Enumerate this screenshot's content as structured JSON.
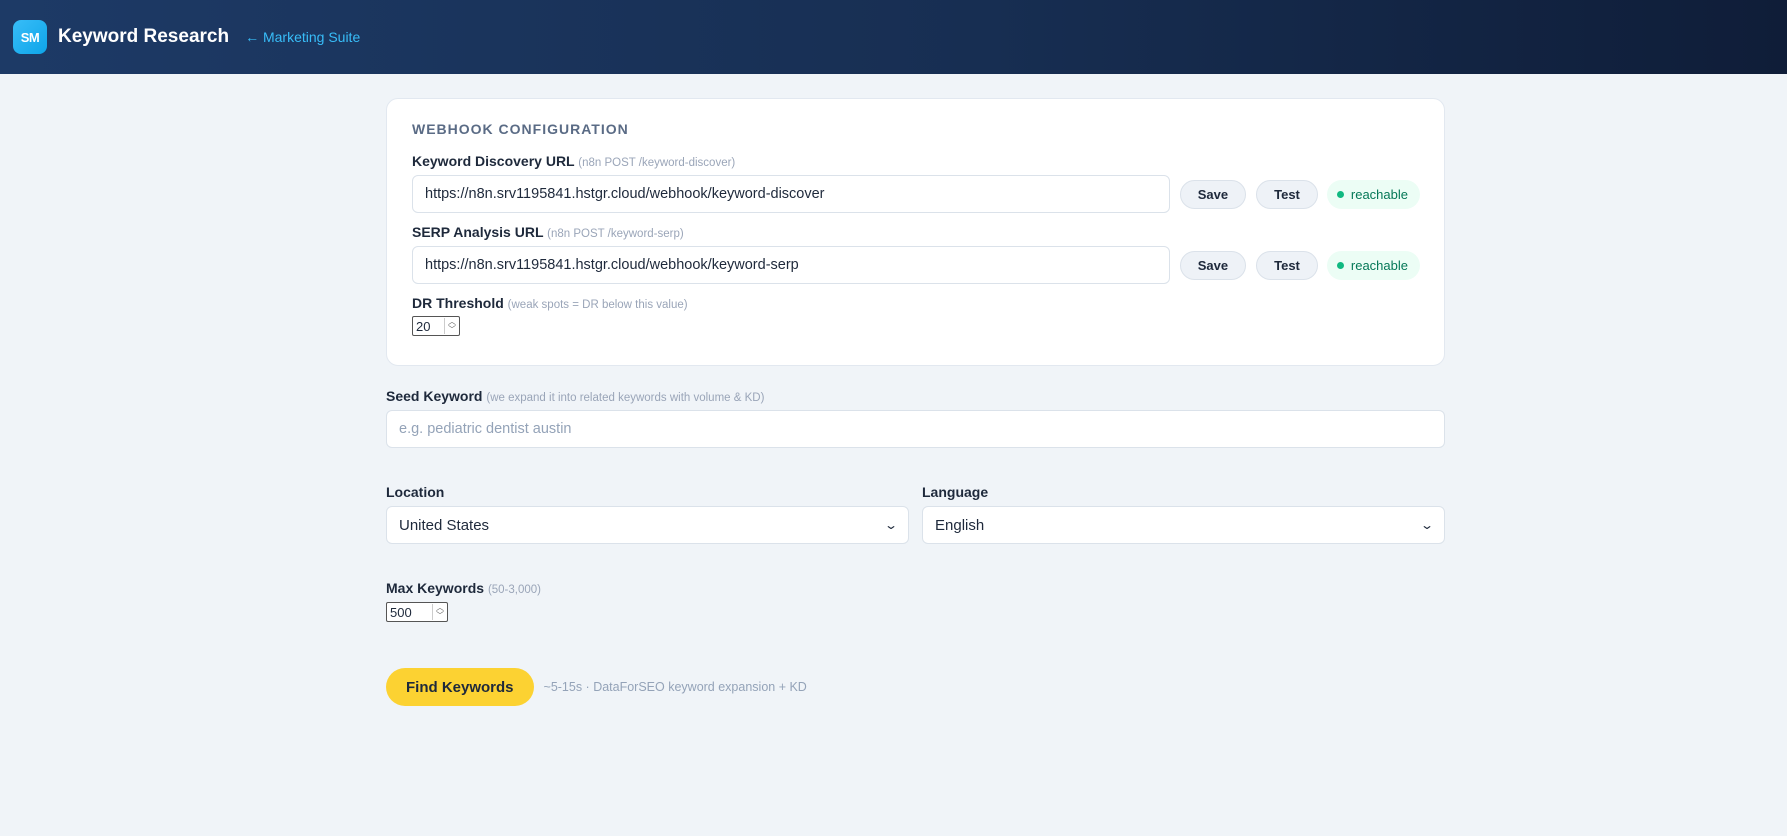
{
  "header": {
    "logo_text": "SM",
    "title": "Keyword Research",
    "back_link": "← Marketing Suite"
  },
  "webhook": {
    "section_title": "WEBHOOK CONFIGURATION",
    "discovery": {
      "label": "Keyword Discovery URL",
      "hint": "(n8n POST /keyword-discover)",
      "value": "https://n8n.srv1195841.hstgr.cloud/webhook/keyword-discover",
      "save_label": "Save",
      "test_label": "Test",
      "status": "reachable"
    },
    "serp": {
      "label": "SERP Analysis URL",
      "hint": "(n8n POST /keyword-serp)",
      "value": "https://n8n.srv1195841.hstgr.cloud/webhook/keyword-serp",
      "save_label": "Save",
      "test_label": "Test",
      "status": "reachable"
    },
    "dr": {
      "label": "DR Threshold",
      "hint": "(weak spots = DR below this value)",
      "value": "20"
    }
  },
  "seed": {
    "label": "Seed Keyword",
    "hint": "(we expand it into related keywords with volume & KD)",
    "placeholder": "e.g. pediatric dentist austin"
  },
  "location": {
    "label": "Location",
    "selected": "United States"
  },
  "language": {
    "label": "Language",
    "selected": "English"
  },
  "max_keywords": {
    "label": "Max Keywords",
    "hint": "(50-3,000)",
    "value": "500"
  },
  "action": {
    "find_label": "Find Keywords",
    "note": "~5-15s · DataForSEO keyword expansion + KD"
  },
  "colors": {
    "accent_yellow": "#fcd232",
    "link_blue": "#38bdf8",
    "status_green": "#10b981",
    "header_dark": "#172e52"
  }
}
